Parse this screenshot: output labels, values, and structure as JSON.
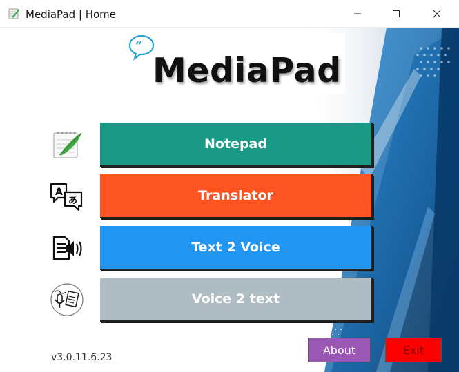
{
  "window": {
    "title": "MediaPad | Home"
  },
  "logo": {
    "text": "MediaPad"
  },
  "menu": [
    {
      "label": "Notepad",
      "icon": "notepad-quill-icon",
      "color": "#1a9a86"
    },
    {
      "label": "Translator",
      "icon": "translate-icon",
      "color": "#fd5522"
    },
    {
      "label": "Text 2 Voice",
      "icon": "text-to-speech-icon",
      "color": "#2196f3"
    },
    {
      "label": "Voice 2 text",
      "icon": "voice-to-text-icon",
      "color": "#b0bcc4"
    }
  ],
  "footer": {
    "version": "v3.0.11.6.23",
    "about_label": "About",
    "exit_label": "Exit"
  },
  "colors": {
    "about_bg": "#9a58b4",
    "exit_bg": "#ff0000",
    "exit_text": "#7a0000",
    "bg_dark_blue": "#0d4c86",
    "bg_mid_blue": "#1e78c2"
  }
}
